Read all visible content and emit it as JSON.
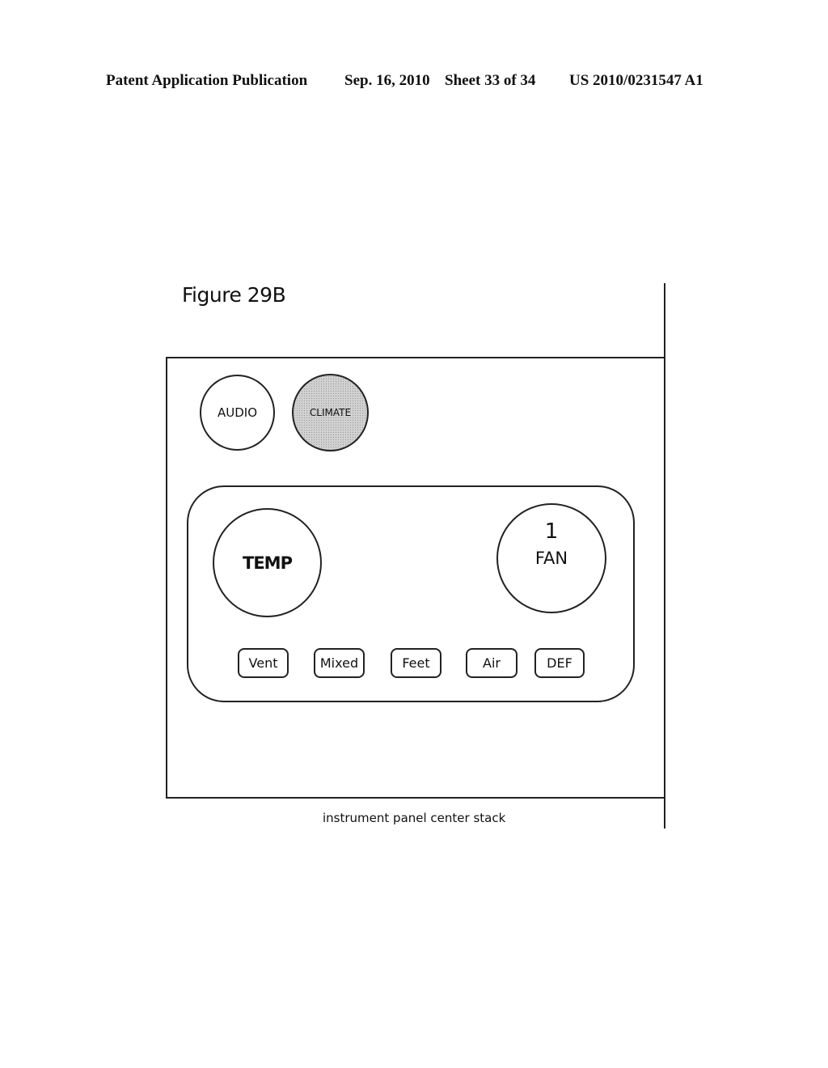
{
  "header": {
    "publication": "Patent Application Publication",
    "date": "Sep. 16, 2010",
    "sheet": "Sheet 33 of 34",
    "patent_number": "US 2010/0231547 A1"
  },
  "figure": {
    "title": "Figure 29B",
    "caption": "instrument panel center stack"
  },
  "stack": {
    "source_buttons": [
      {
        "label": "AUDIO",
        "selected": false
      },
      {
        "label": "CLIMATE",
        "selected": true
      }
    ],
    "climate": {
      "temp_label": "TEMP",
      "fan_label": "FAN",
      "fan_level": "1",
      "modes": [
        "Vent",
        "Mixed",
        "Feet",
        "Air",
        "DEF"
      ]
    }
  },
  "colors": {
    "line": "#222222",
    "selected_fill": "#d2d2d2"
  }
}
